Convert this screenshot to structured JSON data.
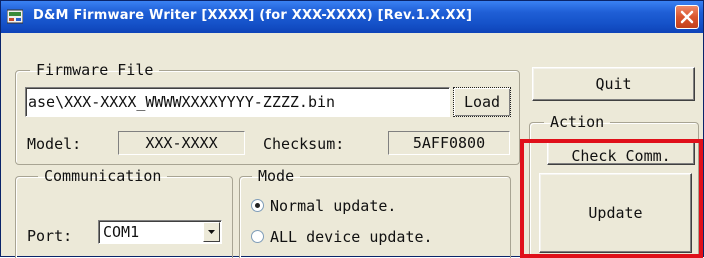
{
  "window": {
    "title": "D&M Firmware Writer [XXXX] (for XXX-XXXX) [Rev.1.X.XX]"
  },
  "firmware_file": {
    "legend": "Firmware File",
    "path_value": "ase\\XXX-XXXX_WWWWXXXXYYYY-ZZZZ.bin",
    "load_label": "Load",
    "model_label": "Model:",
    "model_value": "XXX-XXXX",
    "checksum_label": "Checksum:",
    "checksum_value": "5AFF0800"
  },
  "communication": {
    "legend": "Communication",
    "port_label": "Port:",
    "port_value": "COM1"
  },
  "mode": {
    "legend": "Mode",
    "options": [
      {
        "label": "Normal update.",
        "checked": true
      },
      {
        "label": "ALL device update.",
        "checked": false
      }
    ]
  },
  "action": {
    "quit_label": "Quit",
    "legend": "Action",
    "check_comm_label": "Check Comm.",
    "update_label": "Update"
  },
  "colors": {
    "highlight": "#e0101a",
    "titlebar": "#1552c9"
  }
}
